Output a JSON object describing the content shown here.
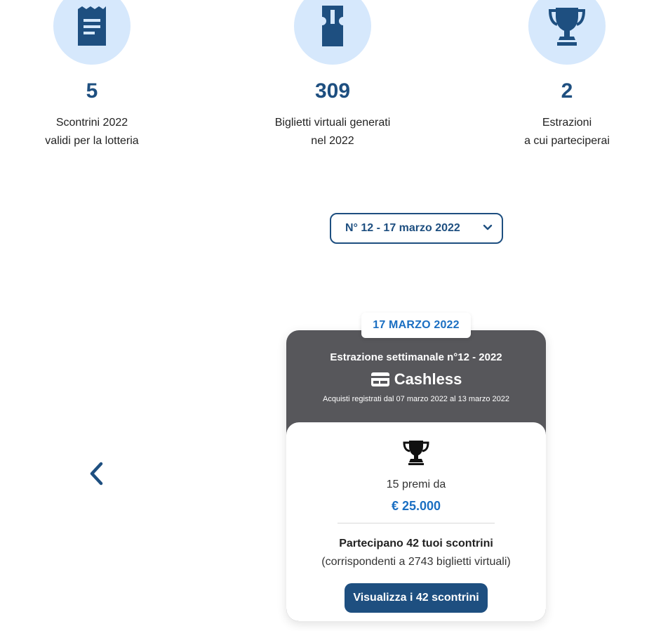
{
  "stats": [
    {
      "icon": "receipt-icon",
      "value": "5",
      "line1": "Scontrini 2022",
      "line2": "validi per la lotteria"
    },
    {
      "icon": "ticket-icon",
      "value": "309",
      "line1": "Biglietti virtuali generati",
      "line2": "nel 2022"
    },
    {
      "icon": "trophy-icon",
      "value": "2",
      "line1": "Estrazioni",
      "line2": "a cui parteciperai"
    }
  ],
  "draw_select": {
    "value": "N° 12 - 17 marzo 2022"
  },
  "card": {
    "date": "17 MARZO 2022",
    "title": "Estrazione settimanale n°12 - 2022",
    "type": "Cashless",
    "period": "Acquisti registrati dal 07 marzo 2022 al 13 marzo 2022",
    "prizes": "15 premi da",
    "amount": "€ 25.000",
    "participate": "Partecipano 42 tuoi scontrini",
    "corresponding": "(corrispondenti a 2743 biglietti virtuali)",
    "button": "Visualizza i 42 scontrini"
  },
  "colors": {
    "primary": "#1e4f80",
    "accent": "#1b6fc2",
    "circle": "#d6e8fc",
    "card_header": "#57575b"
  }
}
